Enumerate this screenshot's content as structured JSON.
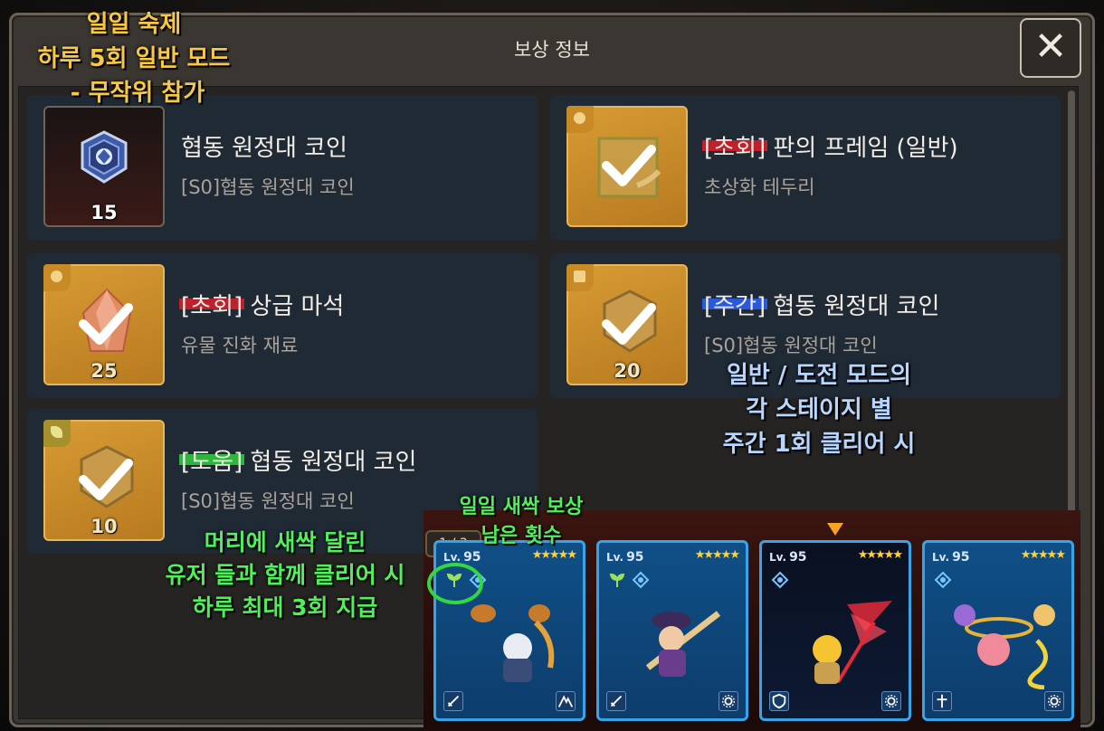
{
  "dialog": {
    "title": "보상 정보",
    "close_label": "✕"
  },
  "rewards": [
    {
      "title": "협동 원정대 코인",
      "subtitle": "[S0]협동 원정대 코인",
      "count": "15",
      "icon": "coop-coin-icon"
    },
    {
      "tag": "[초회]",
      "tag_color": "#d11f2a",
      "title": " 판의 프레임 (일반)",
      "subtitle": "초상화 테두리",
      "count": "",
      "icon": "portrait-frame-icon"
    },
    {
      "tag": "[초회]",
      "tag_color": "#d11f2a",
      "title": " 상급 마석",
      "subtitle": "유물 진화 재료",
      "count": "25",
      "icon": "magic-stone-icon"
    },
    {
      "tag": "[주간]",
      "tag_color": "#2a5ff0",
      "title": " 협동 원정대 코인",
      "subtitle": "[S0]협동 원정대 코인",
      "count": "20",
      "icon": "coop-coin-icon"
    },
    {
      "tag": "[도움]",
      "tag_color": "#2fc53d",
      "title": " 협동 원정대 코인",
      "subtitle": "[S0]협동 원정대 코인",
      "count": "10",
      "icon": "coop-coin-icon"
    }
  ],
  "annotations": {
    "daily_quest": [
      "일일 숙제",
      "하루 5회 일반 모드",
      "- 무작위 참가"
    ],
    "weekly": [
      "일반 / 도전 모드의",
      "각 스테이지 별",
      "주간 1회 클리어 시"
    ],
    "sprout_remaining": [
      "일일 새싹 보상",
      "남은 횟수"
    ],
    "sprout_rule": [
      "머리에 새싹 달린",
      "유저 들과 함께 클리어 시",
      "하루 최대 3회 지급"
    ]
  },
  "party": {
    "counter": "1 / 3",
    "heroes": [
      {
        "level_prefix": "Lv.",
        "level": "95",
        "stars": "★★★★★",
        "sprout": true
      },
      {
        "level_prefix": "Lv.",
        "level": "95",
        "stars": "★★★★★",
        "sprout": true
      },
      {
        "level_prefix": "Lv.",
        "level": "95",
        "stars": "★★★★★",
        "sprout": false
      },
      {
        "level_prefix": "Lv.",
        "level": "95",
        "stars": "★★★★★",
        "sprout": false
      }
    ]
  },
  "colors": {
    "panel_bg": "#3a3631",
    "card_bg": "#1f2a35",
    "gold": "#d79b34",
    "annotation_yellow": "#f7c746",
    "annotation_blue": "#b6d6ff",
    "annotation_green": "#4ff05a"
  }
}
